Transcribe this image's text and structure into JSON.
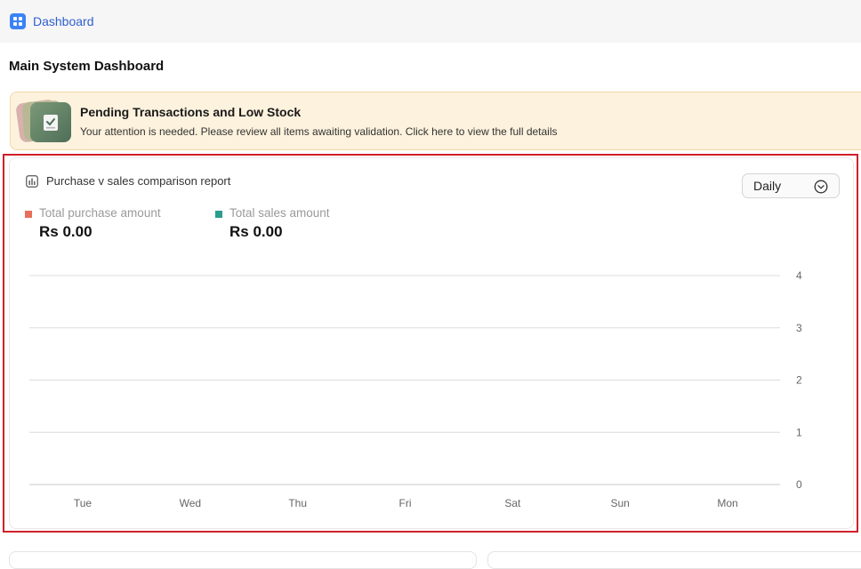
{
  "breadcrumb": {
    "label": "Dashboard",
    "icon": "grid-icon"
  },
  "page": {
    "title": "Main System Dashboard"
  },
  "alert": {
    "title": "Pending Transactions and Low Stock",
    "message": "Your attention is needed. Please review all items awaiting validation. Click here to view the full details",
    "background": "#fdf2dd"
  },
  "report": {
    "title": "Purchase v sales comparison report",
    "icon": "bar-chart-icon",
    "period": "Daily",
    "legend": [
      {
        "label": "Total purchase amount",
        "value": "Rs 0.00",
        "color": "#e8705a"
      },
      {
        "label": "Total sales amount",
        "value": "Rs 0.00",
        "color": "#2a9d8f"
      }
    ]
  },
  "chart_data": {
    "type": "bar",
    "categories": [
      "Tue",
      "Wed",
      "Thu",
      "Fri",
      "Sat",
      "Sun",
      "Mon"
    ],
    "series": [
      {
        "name": "Total purchase amount",
        "values": [
          0,
          0,
          0,
          0,
          0,
          0,
          0
        ],
        "color": "#e8705a"
      },
      {
        "name": "Total sales amount",
        "values": [
          0,
          0,
          0,
          0,
          0,
          0,
          0
        ],
        "color": "#2a9d8f"
      }
    ],
    "y_ticks": [
      0,
      1,
      2,
      3,
      4
    ],
    "ylim": [
      0,
      4
    ],
    "y_axis_position": "right",
    "grid": true,
    "title": "",
    "xlabel": "",
    "ylabel": ""
  },
  "colors": {
    "accent": "#3b82f6",
    "link": "#2f5fd0",
    "highlight": "#d0202a"
  }
}
